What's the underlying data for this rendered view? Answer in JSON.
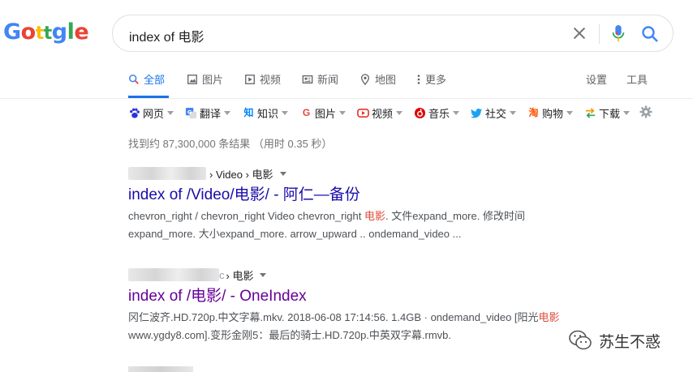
{
  "logo": {
    "letters": [
      "G",
      "o",
      "t",
      "t",
      "g",
      "l",
      "e"
    ],
    "colors": [
      "#4285f4",
      "#ea4335",
      "#fbbc05",
      "#34a853",
      "#4285f4",
      "#34a853",
      "#ea4335"
    ]
  },
  "search": {
    "query": "index of 电影"
  },
  "tabs": [
    {
      "label": "全部",
      "icon": "search-icon",
      "active": true
    },
    {
      "label": "图片",
      "icon": "image-icon"
    },
    {
      "label": "视频",
      "icon": "play-icon"
    },
    {
      "label": "新闻",
      "icon": "news-icon"
    },
    {
      "label": "地图",
      "icon": "map-pin-icon"
    },
    {
      "label": "更多",
      "icon": "more-vert-icon"
    }
  ],
  "settings_label": "设置",
  "tools_label": "工具",
  "extension_bar": [
    {
      "label": "网页",
      "icon": "baidu-paw-icon"
    },
    {
      "label": "翻译",
      "icon": "translate-icon"
    },
    {
      "label": "知识",
      "icon": "zhihu-icon"
    },
    {
      "label": "图片",
      "icon": "google-g-icon"
    },
    {
      "label": "视频",
      "icon": "video-icon"
    },
    {
      "label": "音乐",
      "icon": "netease-music-icon"
    },
    {
      "label": "社交",
      "icon": "twitter-bird-icon"
    },
    {
      "label": "购物",
      "icon": "taobao-icon"
    },
    {
      "label": "下载",
      "icon": "swap-arrows-icon"
    }
  ],
  "stats": "找到约 87,300,000 条结果 （用时 0.35 秒）",
  "results": [
    {
      "breadcrumb": "› Video › 电影",
      "title": "index of /Video/电影/ - 阿仁—备份",
      "snippet_line1_pre": "chevron_right / chevron_right Video chevron_right ",
      "snippet_line1_hl": "电影",
      "snippet_line1_post": ". 文件expand_more. 修改时间",
      "snippet_line2": "expand_more. 大小expand_more. arrow_upward .. ondemand_video ..."
    },
    {
      "breadcrumb": "› 电影",
      "breadcrumb_prefix_char": "c",
      "title": "index of /电影/ - OneIndex",
      "snippet_line1_pre": "冈仁波齐.HD.720p.中文字幕.mkv. 2018-06-08 17:14:56. 1.4GB · ondemand_video [阳光",
      "snippet_line1_hl": "电影",
      "snippet_line2": "www.ygdy8.com].变形金刚5：最后的骑士.HD.720p.中英双字幕.rmvb."
    }
  ],
  "watermark": {
    "text": "苏生不惑"
  }
}
